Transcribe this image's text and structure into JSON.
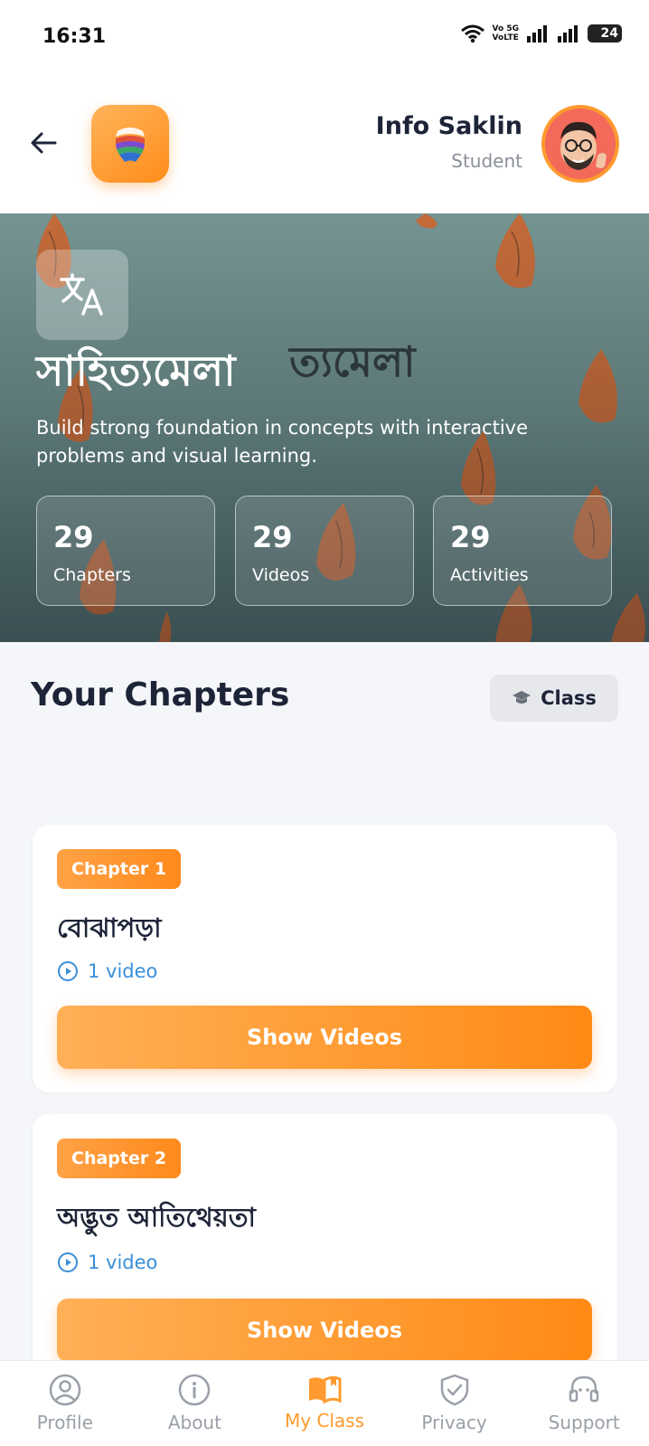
{
  "status_bar": {
    "time": "16:31",
    "volte_top": "Vo 5G",
    "volte_bottom": "VoLTE",
    "battery": "24"
  },
  "header": {
    "user_name": "Info Saklin",
    "user_role": "Student"
  },
  "hero": {
    "title": "সাহিত্যমেলা",
    "description": "Build strong foundation in concepts with interactive problems and visual learning.",
    "stats": [
      {
        "value": "29",
        "label": "Chapters"
      },
      {
        "value": "29",
        "label": "Videos"
      },
      {
        "value": "29",
        "label": "Activities"
      }
    ]
  },
  "section": {
    "title": "Your Chapters",
    "class_button": "Class"
  },
  "chapters": [
    {
      "badge": "Chapter 1",
      "title": "বোঝাপড়া",
      "videos": "1 video",
      "button": "Show Videos"
    },
    {
      "badge": "Chapter 2",
      "title": "অদ্ভুত আতিথেয়তা",
      "videos": "1 video",
      "button": "Show Videos"
    }
  ],
  "bottom_nav": [
    {
      "label": "Profile",
      "icon": "profile-icon"
    },
    {
      "label": "About",
      "icon": "info-icon"
    },
    {
      "label": "My Class",
      "icon": "book-icon"
    },
    {
      "label": "Privacy",
      "icon": "shield-icon"
    },
    {
      "label": "Support",
      "icon": "headset-icon"
    }
  ],
  "colors": {
    "accent": "#ff9a2f",
    "link": "#3a8fd8",
    "text_dark": "#1d2438"
  }
}
